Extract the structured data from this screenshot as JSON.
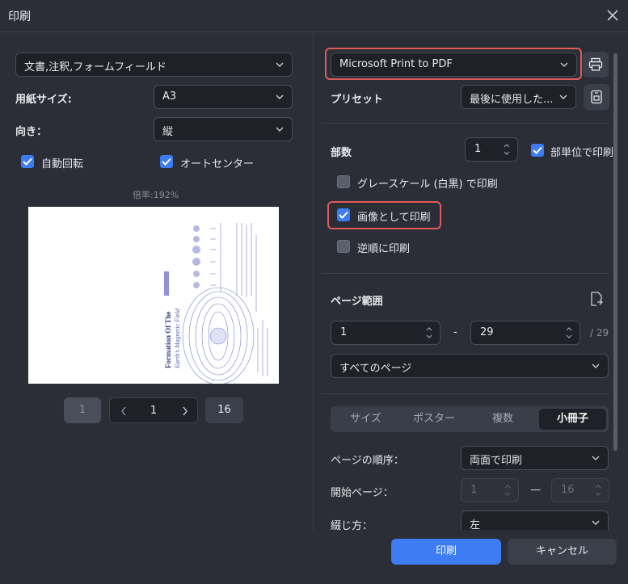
{
  "window": {
    "title": "印刷"
  },
  "left": {
    "content_select": "文書,注釈,フォームフィールド",
    "paper_size_label": "用紙サイズ:",
    "paper_size_value": "A3",
    "orientation_label": "向き：",
    "orientation_value": "縦",
    "auto_rotate_label": "自動回転",
    "auto_center_label": "オートセンター",
    "zoom_text": "倍率:192%",
    "preview": {
      "title_line1": "Formation Of The",
      "title_line2": "Earth’s Magnetic Field"
    },
    "pagination": {
      "first": "1",
      "current": "1",
      "last": "16"
    }
  },
  "right": {
    "printer": "Microsoft Print to PDF",
    "preset_label": "プリセット",
    "preset_value": "最後に使用した...",
    "copies_label": "部数",
    "copies_value": "1",
    "collate_label": "部単位で印刷",
    "grayscale_label": "グレースケール (白黒) で印刷",
    "print_as_image_label": "画像として印刷",
    "reverse_label": "逆順に印刷",
    "page_range_label": "ページ範囲",
    "range_from": "1",
    "range_dash": "-",
    "range_to": "29",
    "range_total": "/ 29",
    "range_select": "すべてのページ",
    "tabs": [
      "サイズ",
      "ポスター",
      "複数",
      "小冊子"
    ],
    "page_order_label": "ページの順序：",
    "page_order_value": "両面で印刷",
    "start_page_label": "開始ページ：",
    "start_from": "1",
    "start_dash": "—",
    "start_to": "16",
    "binding_label": "綴じ方：",
    "binding_value": "左"
  },
  "footer": {
    "print_button": "印刷",
    "cancel_button": "キャンセル"
  },
  "colors": {
    "accent": "#3d7cf2",
    "highlight": "#e05a5a",
    "background": "#2b2e37"
  }
}
